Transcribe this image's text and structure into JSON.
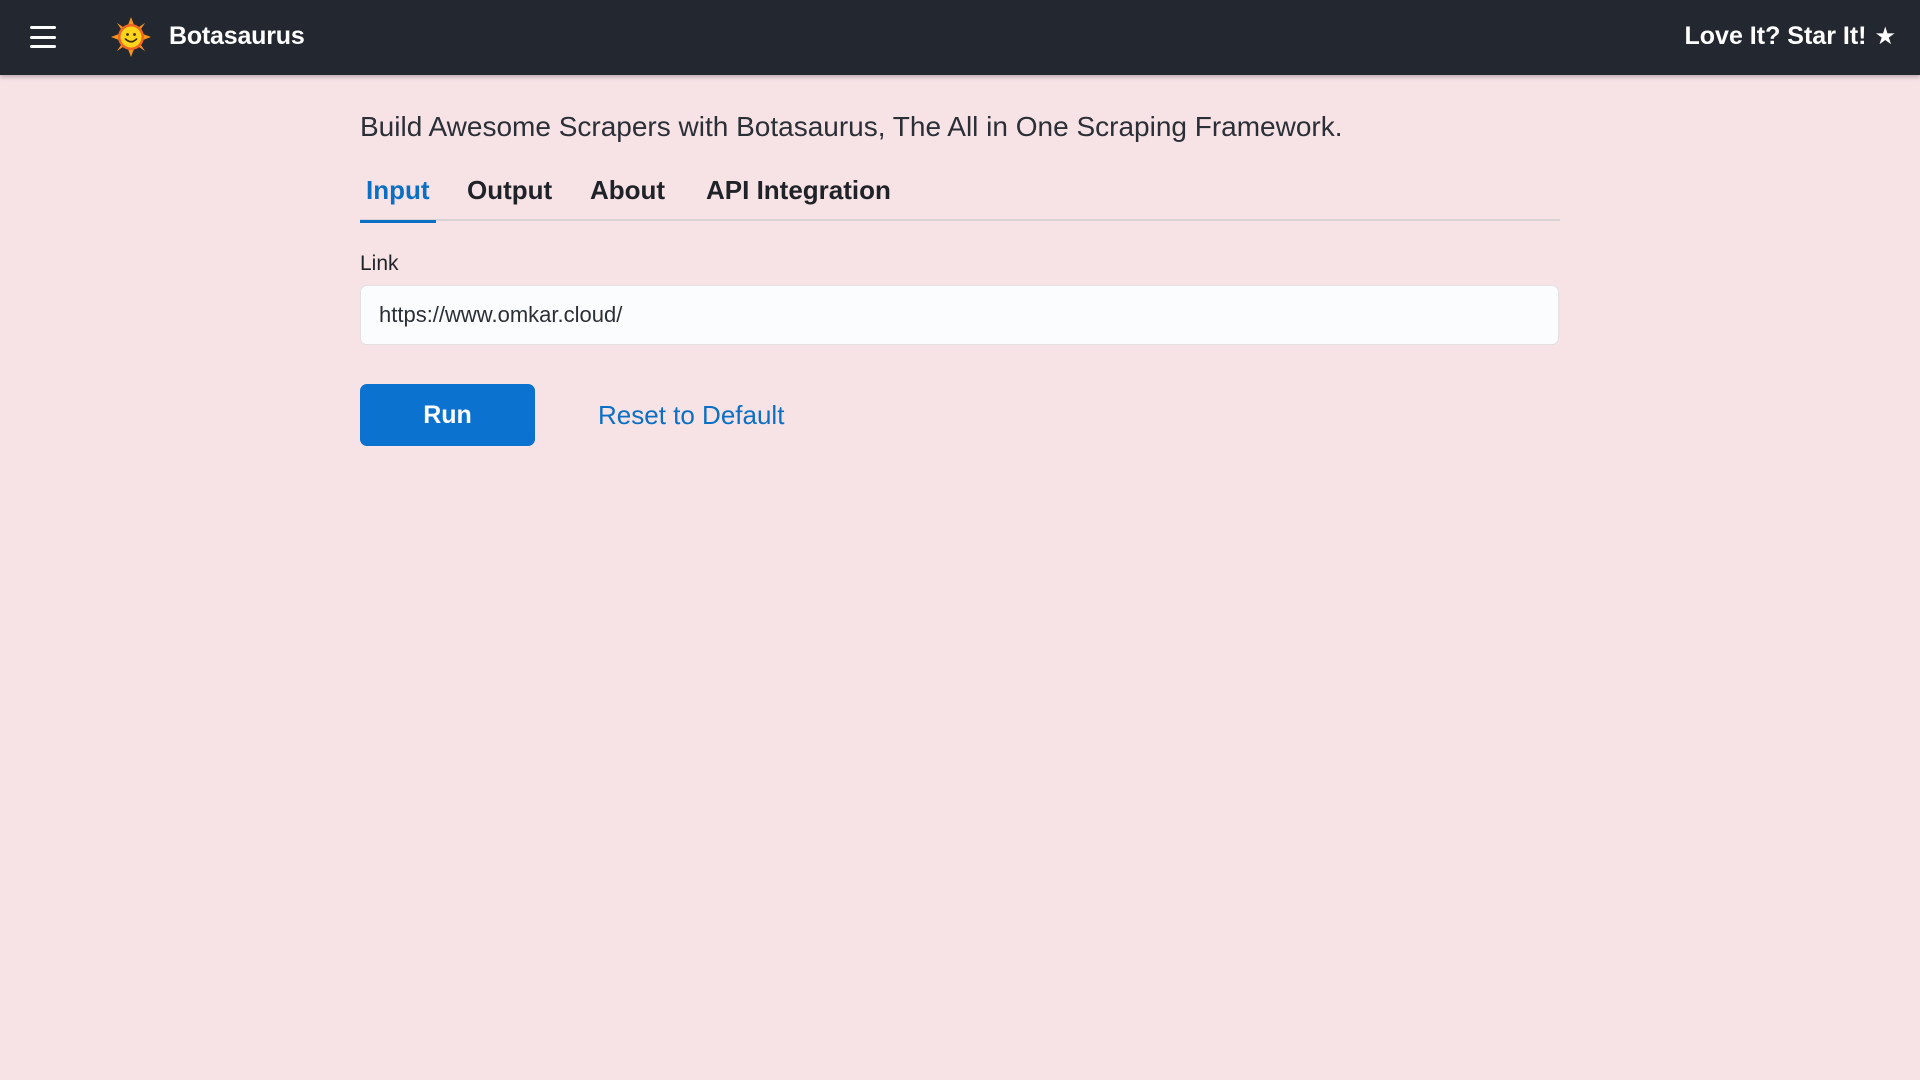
{
  "header": {
    "brand": "Botasaurus",
    "star_cta": "Love It? Star It!",
    "star_glyph": "★"
  },
  "main": {
    "headline": "Build Awesome Scrapers with Botasaurus, The All in One Scraping Framework.",
    "tabs": [
      {
        "label": "Input",
        "active": true
      },
      {
        "label": "Output",
        "active": false
      },
      {
        "label": "About",
        "active": false
      },
      {
        "label": "API Integration",
        "active": false
      }
    ],
    "form": {
      "link_label": "Link",
      "link_value": "https://www.omkar.cloud/"
    },
    "run_label": "Run",
    "reset_label": "Reset to Default"
  },
  "icons": {
    "menu": "hamburger-menu-icon",
    "logo": "sun-logo-icon",
    "star": "star-icon"
  },
  "colors": {
    "topbar": "#23272f",
    "background": "#f7e2e6",
    "accent": "#0b6fc4",
    "run_button": "#0b72cf"
  }
}
